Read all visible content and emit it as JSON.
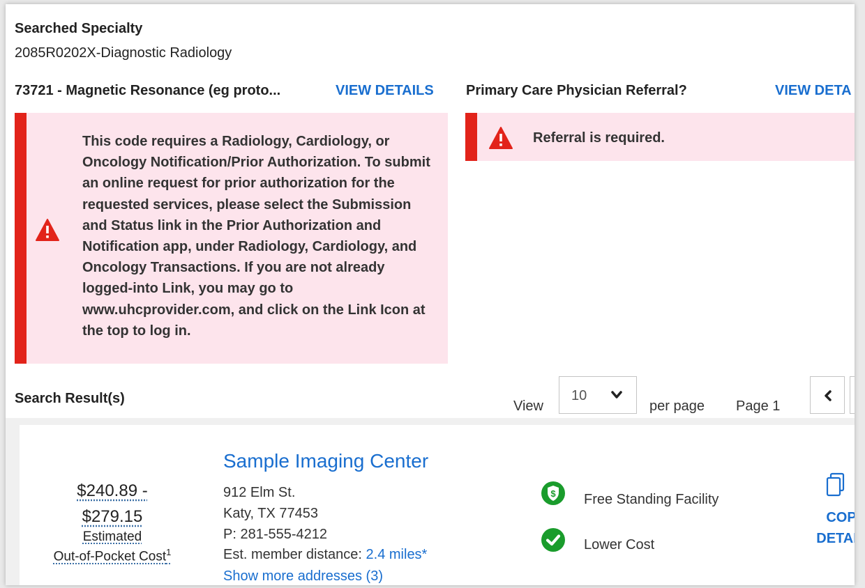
{
  "header": {
    "specialty_label": "Searched Specialty",
    "specialty_value": "2085R0202X-Diagnostic Radiology"
  },
  "procedure": {
    "title": "73721 - Magnetic Resonance (eg proto...",
    "view_details": "VIEW DETAILS",
    "alert_text": "This code requires a Radiology, Cardiology, or Oncology Notification/Prior Authorization. To submit an online request for prior authorization for the requested services, please select the Submission and Status link in the Prior Authorization and Notification app, under Radiology, Cardiology, and Oncology Transactions. If you are not already logged-into Link, you may go to www.uhcprovider.com, and click on the Link Icon at the top to log in."
  },
  "referral": {
    "title": "Primary Care Physician Referral?",
    "view_details": "VIEW DETA",
    "alert_text": "Referral is required."
  },
  "results": {
    "label": "Search Result(s)",
    "view_label": "View",
    "per_page_value": "10",
    "per_page_label": "per page",
    "page_label": "Page 1"
  },
  "provider": {
    "cost_range_low": "$240.89 -",
    "cost_range_high": "$279.15",
    "cost_label_1": "Estimated",
    "cost_label_2": "Out-of-Pocket Cost",
    "cost_footnote": "1",
    "name": "Sample Imaging Center",
    "address_line1": "912 Elm St.",
    "address_line2": "Katy, TX 77453",
    "phone": "P: 281-555-4212",
    "distance_label": "Est. member distance:",
    "distance_value": "2.4 miles*",
    "more_addresses": "Show more addresses (3)",
    "badge_1": "Free Standing Facility",
    "badge_2": "Lower Cost",
    "copy_line1": "COPY",
    "copy_line2": "DETAIL"
  },
  "colors": {
    "link": "#196ecf",
    "alert_bg": "#fde4ec",
    "alert_bar": "#e2231a",
    "badge_green": "#1a9c2c"
  },
  "icons": [
    "warning-triangle-icon",
    "chevron-down-icon",
    "chevron-left-icon",
    "dollar-shield-icon",
    "checkmark-circle-icon",
    "copy-icon"
  ]
}
